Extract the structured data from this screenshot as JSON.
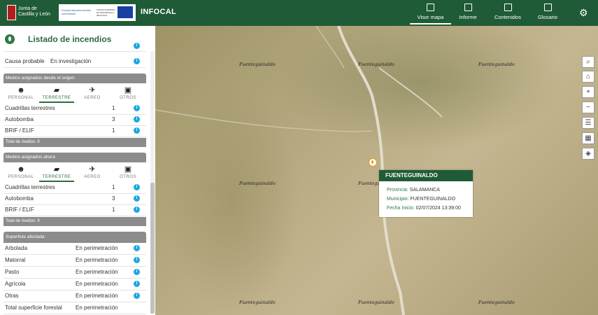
{
  "header": {
    "jcyl_line1": "Junta de",
    "jcyl_line2": "Castilla y León",
    "eu_text1": "Europa impulsa nuestro crecimiento",
    "eu_text2": "FONDO EUROPEO DE DESARROLLO REGIONAL",
    "app_name": "INFOCAL",
    "nav": [
      {
        "label": "Visor mapa",
        "icon": "map-icon"
      },
      {
        "label": "Informe",
        "icon": "report-icon"
      },
      {
        "label": "Contenidos",
        "icon": "contents-icon"
      },
      {
        "label": "Glosario",
        "icon": "glossary-icon"
      }
    ],
    "settings_icon": "gear-icon"
  },
  "panel": {
    "title": "Listado de incendios",
    "cause": {
      "label": "Causa probable",
      "value": "En investigación"
    },
    "origin": {
      "title": "Medios asignados desde el origen",
      "tabs": [
        "PERSONAL",
        "TERRESTRE",
        "AEREO",
        "OTROS"
      ],
      "selected_tab": "TERRESTRE",
      "rows": [
        {
          "label": "Cuadrillas terrestres",
          "count": "1"
        },
        {
          "label": "Autobomba",
          "count": "3"
        },
        {
          "label": "BRIF / ELIF",
          "count": "1"
        }
      ],
      "total": "Total de medios: 9"
    },
    "now": {
      "title": "Medios asignados ahora",
      "tabs": [
        "PERSONAL",
        "TERRESTRE",
        "AEREO",
        "OTROS"
      ],
      "selected_tab": "TERRESTRE",
      "rows": [
        {
          "label": "Cuadrillas terrestres",
          "count": "1"
        },
        {
          "label": "Autobomba",
          "count": "3"
        },
        {
          "label": "BRIF / ELIF",
          "count": "1"
        }
      ],
      "total": "Total de medios: 9"
    },
    "surface": {
      "title": "Superficie afectada",
      "rows": [
        {
          "label": "Arbolada",
          "value": "En perimetración"
        },
        {
          "label": "Matorral",
          "value": "En perimetración"
        },
        {
          "label": "Pasto",
          "value": "En perimetración"
        },
        {
          "label": "Agrícola",
          "value": "En perimetración"
        },
        {
          "label": "Otras",
          "value": "En perimetración"
        },
        {
          "label": "Total superficie forestal",
          "value": "En perimetración"
        }
      ]
    }
  },
  "map": {
    "place_label": "Fuenteguinaldo",
    "popup": {
      "title": "FUENTEGUINALDO",
      "provincia_label": "Provincia:",
      "provincia": "SALAMANCA",
      "municipio_label": "Municipio:",
      "municipio": "FUENTEGUINALDO",
      "fecha_label": "Fecha Inicio:",
      "fecha": "02/07/2024 13:39:00"
    },
    "tools": [
      "search-icon",
      "home-icon",
      "zoom-in-icon",
      "zoom-out-icon",
      "legend-icon",
      "qr-icon",
      "layers-icon"
    ]
  }
}
